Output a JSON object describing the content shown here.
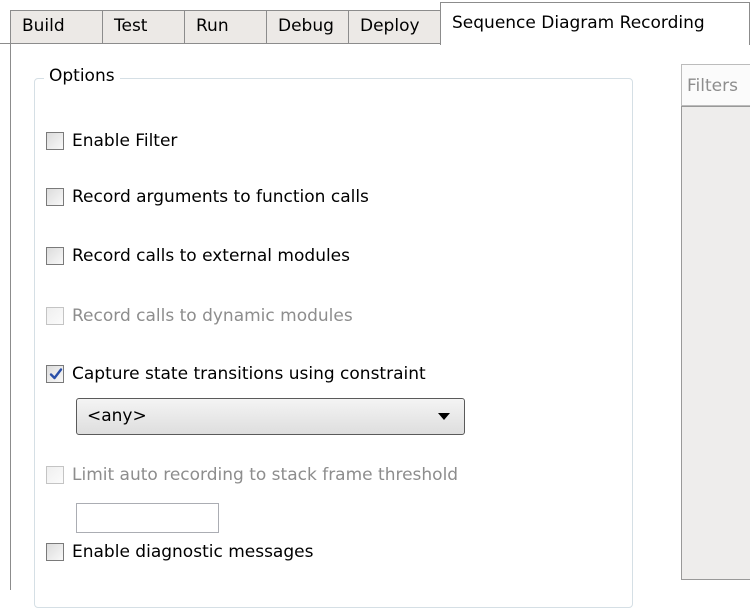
{
  "tabs": [
    {
      "label": "Build"
    },
    {
      "label": "Test"
    },
    {
      "label": "Run"
    },
    {
      "label": "Debug"
    },
    {
      "label": "Deploy"
    },
    {
      "label": "Sequence Diagram Recording",
      "active": true
    }
  ],
  "options": {
    "group_label": "Options",
    "checkboxes": [
      {
        "label": "Enable Filter",
        "checked": false,
        "enabled": true
      },
      {
        "label": "Record arguments to function calls",
        "checked": false,
        "enabled": true
      },
      {
        "label": "Record calls to external modules",
        "checked": false,
        "enabled": true
      },
      {
        "label": "Record calls to dynamic modules",
        "checked": false,
        "enabled": false
      },
      {
        "label": "Capture state transitions using constraint",
        "checked": true,
        "enabled": true
      },
      {
        "label": "Limit auto recording to stack frame threshold",
        "checked": false,
        "enabled": false
      },
      {
        "label": "Enable diagnostic messages",
        "checked": false,
        "enabled": true
      }
    ],
    "constraint_select": {
      "selected": "<any>"
    },
    "threshold_input": {
      "value": ""
    }
  },
  "filters": {
    "header": "Filters"
  }
}
